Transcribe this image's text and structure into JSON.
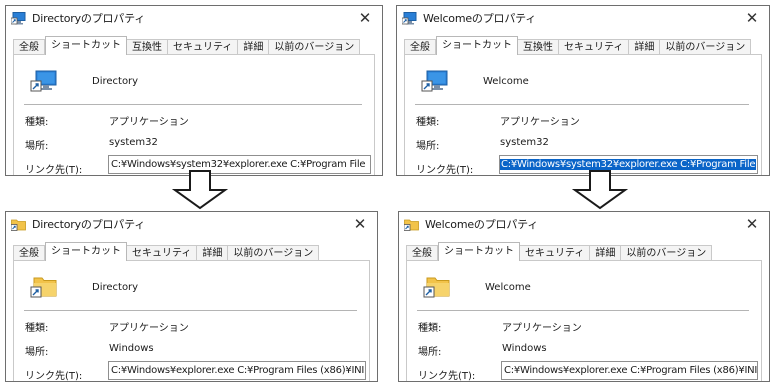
{
  "dialogs": [
    {
      "title": "Directoryのプロパティ",
      "tabs": [
        "全般",
        "ショートカット",
        "互換性",
        "セキュリティ",
        "詳細",
        "以前のバージョン"
      ],
      "name": "Directory",
      "type_label": "種類:",
      "type_value": "アプリケーション",
      "location_label": "場所:",
      "location_value": "system32",
      "link_label": "リンク先(T):",
      "link_value": "C:¥Windows¥system32¥explorer.exe C:¥Program File",
      "icon": "computer-shortcut-icon"
    },
    {
      "title": "Welcomeのプロパティ",
      "tabs": [
        "全般",
        "ショートカット",
        "互換性",
        "セキュリティ",
        "詳細",
        "以前のバージョン"
      ],
      "name": "Welcome",
      "type_label": "種類:",
      "type_value": "アプリケーション",
      "location_label": "場所:",
      "location_value": "system32",
      "link_label": "リンク先(T):",
      "link_value": "C:¥Windows¥system32¥explorer.exe C:¥Program File",
      "link_selected": true,
      "icon": "computer-shortcut-icon"
    },
    {
      "title": "Directoryのプロパティ",
      "tabs": [
        "全般",
        "ショートカット",
        "セキュリティ",
        "詳細",
        "以前のバージョン"
      ],
      "name": "Directory",
      "type_label": "種類:",
      "type_value": "アプリケーション",
      "location_label": "場所:",
      "location_value": "Windows",
      "link_label": "リンク先(T):",
      "link_value": "C:¥Windows¥explorer.exe C:¥Program Files (x86)¥INI",
      "icon": "folder-shortcut-icon"
    },
    {
      "title": "Welcomeのプロパティ",
      "tabs": [
        "全般",
        "ショートカット",
        "セキュリティ",
        "詳細",
        "以前のバージョン"
      ],
      "name": "Welcome",
      "type_label": "種類:",
      "type_value": "アプリケーション",
      "location_label": "場所:",
      "location_value": "Windows",
      "link_label": "リンク先(T):",
      "link_value": "C:¥Windows¥explorer.exe C:¥Program Files (x86)¥INI",
      "icon": "folder-shortcut-icon"
    }
  ],
  "close_glyph": "✕",
  "colors": {
    "selection": "#0a64c8",
    "border": "#6e6e6e",
    "arrow_fill": "#ffffff",
    "arrow_stroke": "#1a1a1a"
  }
}
